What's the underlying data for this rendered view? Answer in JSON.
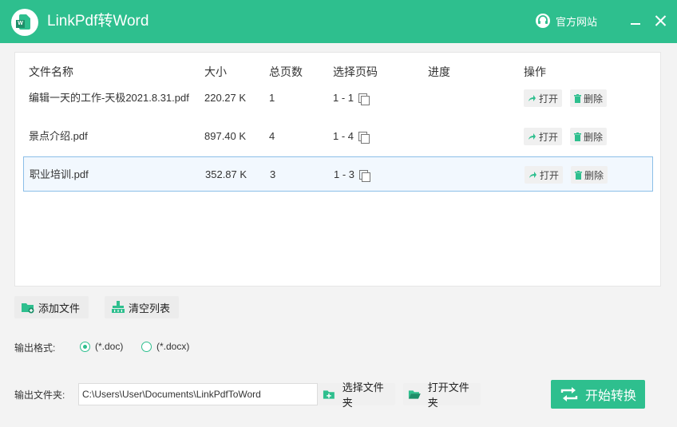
{
  "app": {
    "title": "LinkPdf转Word",
    "logo_letter": "W"
  },
  "titlebar": {
    "site_link": "官方网站"
  },
  "colors": {
    "accent": "#2ebf8e",
    "selected_border": "#8cbfe8"
  },
  "table": {
    "headers": {
      "name": "文件名称",
      "size": "大小",
      "pages": "总页数",
      "page_select": "选择页码",
      "progress": "进度",
      "actions": "操作"
    },
    "rows": [
      {
        "name": "编辑一天的工作-天极2021.8.31.pdf",
        "size": "220.27 K",
        "pages": "1",
        "range": "1 - 1",
        "progress": "",
        "open": "打开",
        "delete": "删除",
        "selected": false
      },
      {
        "name": "景点介绍.pdf",
        "size": "897.40 K",
        "pages": "4",
        "range": "1 - 4",
        "progress": "",
        "open": "打开",
        "delete": "删除",
        "selected": false
      },
      {
        "name": "职业培训.pdf",
        "size": "352.87 K",
        "pages": "3",
        "range": "1 - 3",
        "progress": "",
        "open": "打开",
        "delete": "删除",
        "selected": true
      }
    ]
  },
  "toolbar": {
    "add_file": "添加文件",
    "clear_list": "清空列表"
  },
  "output_format": {
    "label": "输出格式:",
    "options": [
      {
        "label": "(*.doc)",
        "checked": true
      },
      {
        "label": "(*.docx)",
        "checked": false
      }
    ]
  },
  "output_folder": {
    "label": "输出文件夹:",
    "path": "C:\\Users\\User\\Documents\\LinkPdfToWord",
    "choose": "选择文件夹",
    "open": "打开文件夹"
  },
  "start": {
    "label": "开始转换"
  },
  "icons": [
    "app-logo",
    "headset-icon",
    "minimize-icon",
    "close-icon",
    "copy-icon",
    "share-arrow-icon",
    "trash-icon",
    "folder-add-icon",
    "clear-list-icon",
    "folder-plus-icon",
    "folder-open-icon",
    "convert-arrows-icon"
  ]
}
